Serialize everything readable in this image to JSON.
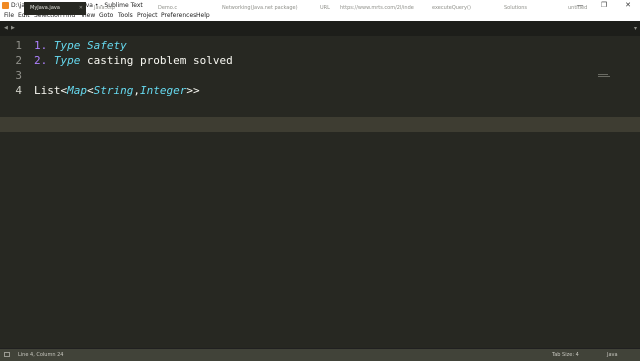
{
  "window": {
    "title": "D:\\javap\\demo\\MyJava.java • - Sublime Text",
    "minimize": "—",
    "maximize": "❐",
    "close": "✕"
  },
  "menu": [
    "File",
    "Edit",
    "Selection",
    "Find",
    "View",
    "Goto",
    "Tools",
    "Project",
    "Preferences",
    "Help"
  ],
  "tabs": [
    {
      "label": "MyJava.java",
      "active": true
    },
    {
      "label": "Java.xsp",
      "active": false
    },
    {
      "label": "Demo.c",
      "active": false
    },
    {
      "label": "Networking(Java.net package)",
      "active": false
    },
    {
      "label": "URL",
      "active": false
    },
    {
      "label": "https://www.mrts.com/2l/inde",
      "active": false
    },
    {
      "label": "executeQuery()",
      "active": false
    },
    {
      "label": "Solutions",
      "active": false
    },
    {
      "label": "untitled",
      "active": false
    }
  ],
  "tabbar": {
    "prev": "◀",
    "next": "▶",
    "overflow": "▾"
  },
  "editor": {
    "line_numbers": [
      "1",
      "2",
      "3",
      "4"
    ],
    "lines": {
      "l1": {
        "num": "1.",
        "kw": "Type",
        "rest": " Safety",
        "kw2": ""
      },
      "l2": {
        "num": "2.",
        "kw": "Type",
        "rest": " casting problem solved"
      },
      "l4": {
        "t1": "List<",
        "kw1": "Map",
        "t2": "<",
        "kw2": "String",
        "t3": ",",
        "kw3": "Integer",
        "t4": ">>"
      }
    }
  },
  "status": {
    "position": "Line 4, Column 24",
    "tab_size": "Tab Size: 4",
    "syntax": "Java"
  },
  "colors": {
    "background": "#272822",
    "number": "#ae81ff",
    "keyword": "#66d9ef",
    "text": "#f8f8f2",
    "current_line": "#3e3d32"
  }
}
